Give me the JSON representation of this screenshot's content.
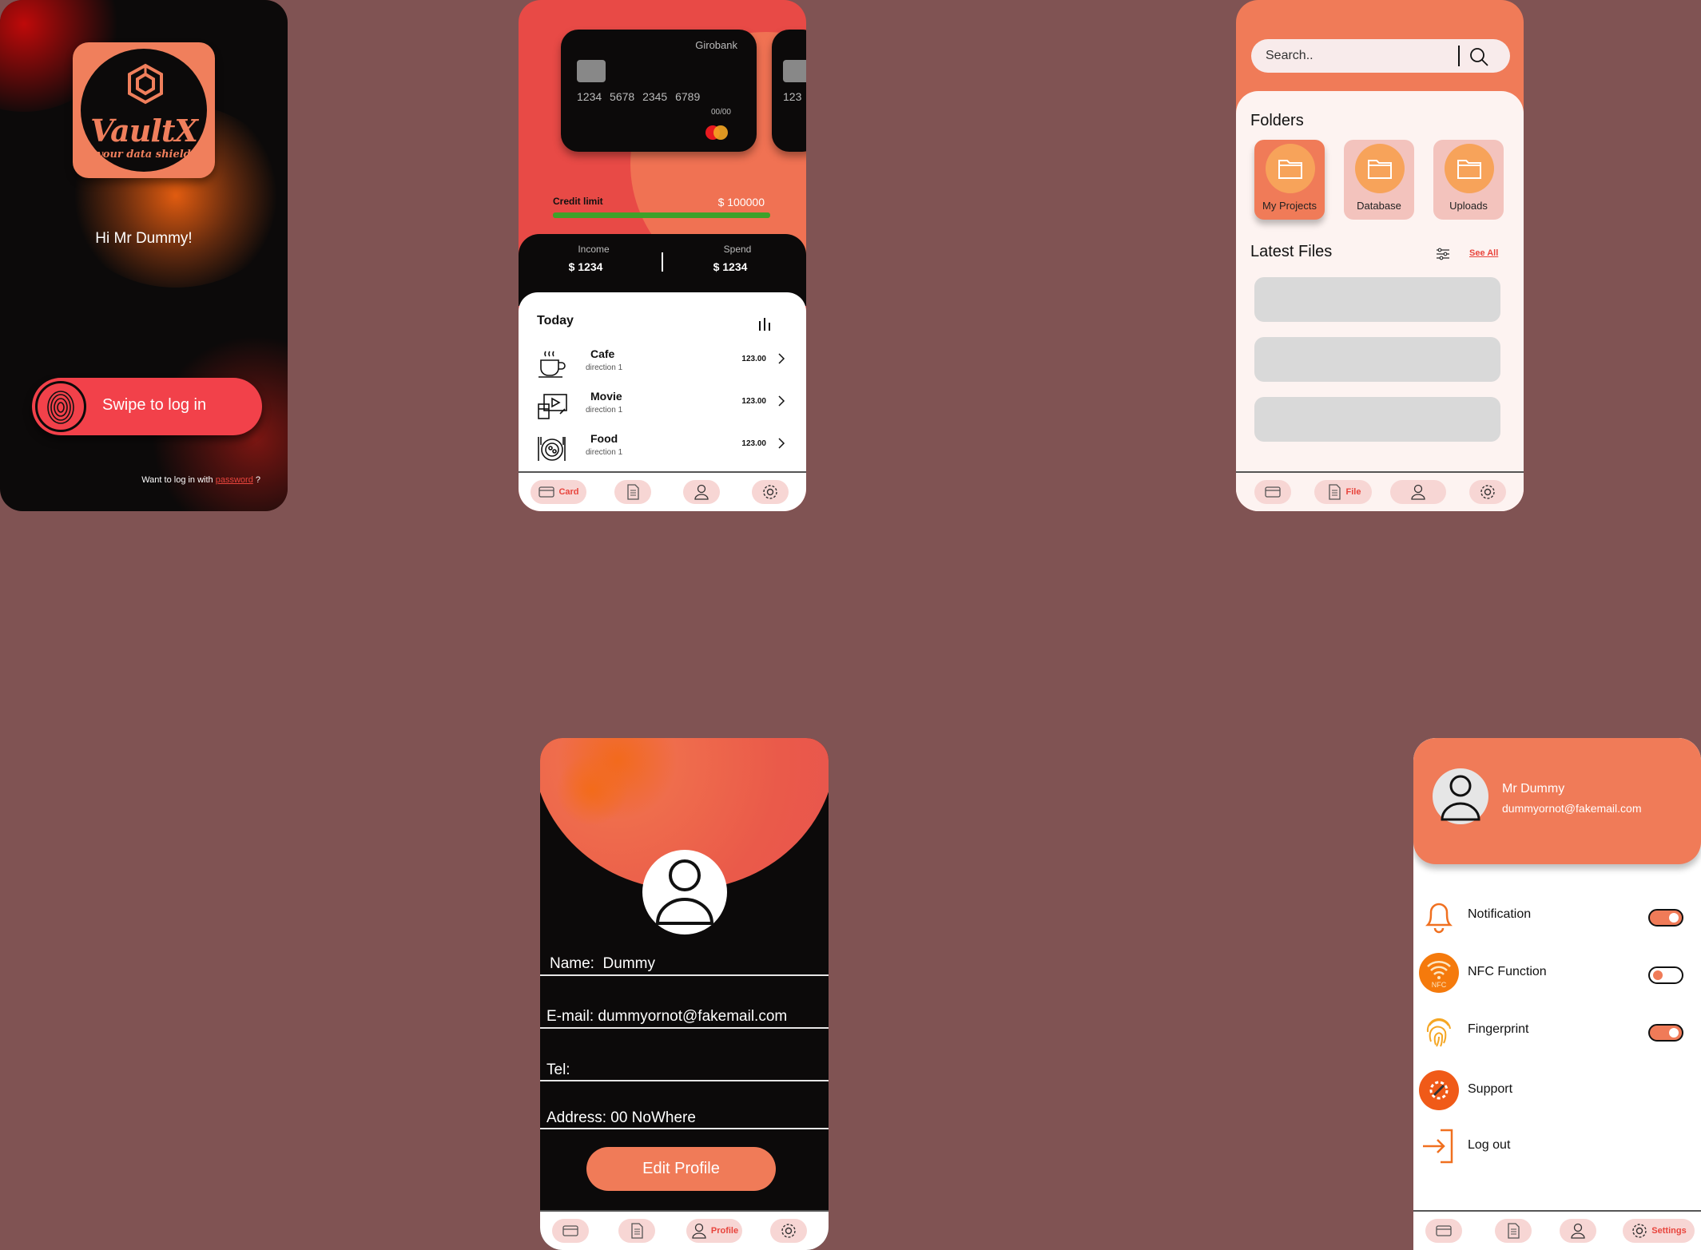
{
  "colors": {
    "background": "#805353",
    "accent": "#f07b58",
    "brand_red": "#f2414a",
    "dark": "#0c0a0a",
    "credit_bar": "#3ea12a"
  },
  "login": {
    "logo_text": "VaultX",
    "logo_tagline": "your data shield",
    "greeting": "Hi Mr Dummy!",
    "swipe_label": "Swipe to log in",
    "password_prefix": "Want to log in with ",
    "password_link": "password",
    "password_suffix": " ?"
  },
  "cards": {
    "bank_name": "Girobank",
    "card_number": "1234 5678 2345 6789",
    "card_expiry": "00/00",
    "next_card_number": "123",
    "credit_limit_label": "Credit limit",
    "credit_limit_value": "$ 100000",
    "income_label": "Income",
    "income_value": "$ 1234",
    "spend_label": "Spend",
    "spend_value": "$ 1234",
    "today_title": "Today",
    "transactions": [
      {
        "name": "Cafe",
        "sub": "direction 1",
        "amount": "123.00",
        "icon": "coffee-icon"
      },
      {
        "name": "Movie",
        "sub": "direction 1",
        "amount": "123.00",
        "icon": "movie-icon"
      },
      {
        "name": "Food",
        "sub": "direction 1",
        "amount": "123.00",
        "icon": "food-icon"
      }
    ],
    "nav": {
      "card_label": "Card"
    }
  },
  "files": {
    "search_placeholder": "Search..",
    "folders_title": "Folders",
    "folders": [
      {
        "label": "My Projects"
      },
      {
        "label": "Database"
      },
      {
        "label": "Uploads"
      }
    ],
    "latest_title": "Latest Files",
    "see_all": "See All",
    "nav": {
      "file_label": "File"
    }
  },
  "profile": {
    "name_label": "Name:",
    "name_value": "Dummy",
    "email_label": "E-mail:",
    "email_value": "dummyornot@fakemail.com",
    "tel_label": "Tel:",
    "tel_value": "",
    "address_label": "Address:",
    "address_value": "00 NoWhere",
    "edit_button": "Edit Profile",
    "nav": {
      "profile_label": "Profile"
    }
  },
  "settings": {
    "user_name": "Mr Dummy",
    "user_email": "dummyornot@fakemail.com",
    "rows": [
      {
        "label": "Notification",
        "icon": "bell-icon",
        "toggle": true
      },
      {
        "label": "NFC Function",
        "icon": "nfc-icon",
        "toggle": false
      },
      {
        "label": "Fingerprint",
        "icon": "fingerprint-icon",
        "toggle": true
      },
      {
        "label": "Support",
        "icon": "support-icon"
      },
      {
        "label": "Log out",
        "icon": "logout-icon"
      }
    ],
    "nfc_badge": "NFC",
    "nav": {
      "settings_label": "Settings"
    }
  }
}
